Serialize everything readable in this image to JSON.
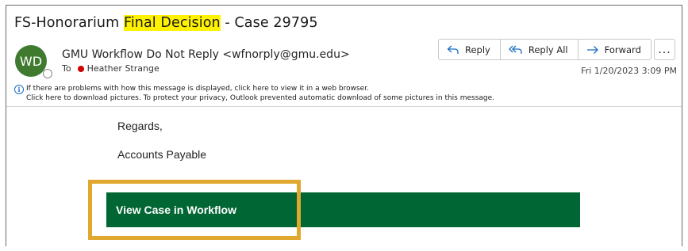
{
  "message": {
    "subject_prefix": "FS-Honorarium ",
    "subject_highlight": "Final Decision",
    "subject_suffix": " - Case 29795",
    "sender_initials": "WD",
    "sender": "GMU Workflow Do Not Reply <wfnorply@gmu.edu>",
    "to_label": "To",
    "recipient": "Heather Strange",
    "date": "Fri 1/20/2023 3:09 PM"
  },
  "actions": {
    "reply": "Reply",
    "reply_all": "Reply All",
    "forward": "Forward",
    "more": "..."
  },
  "infobar": {
    "line1": "If there are problems with how this message is displayed, click here to view it in a web browser.",
    "line2": "Click here to download pictures. To protect your privacy, Outlook prevented automatic download of some pictures in this message."
  },
  "body": {
    "regards": "Regards,",
    "signature": "Accounts Payable",
    "cta_label": "View Case in Workflow"
  },
  "colors": {
    "highlight": "#fff200",
    "avatar": "#3f7a2f",
    "cta_bar": "#006633",
    "annotation_box": "#e0a82e",
    "accent_blue": "#1b6fc2"
  },
  "icons": {
    "reply": "reply-arrow-icon",
    "reply_all": "reply-all-arrow-icon",
    "forward": "forward-arrow-icon",
    "more": "more-options-icon",
    "info": "info-icon"
  }
}
